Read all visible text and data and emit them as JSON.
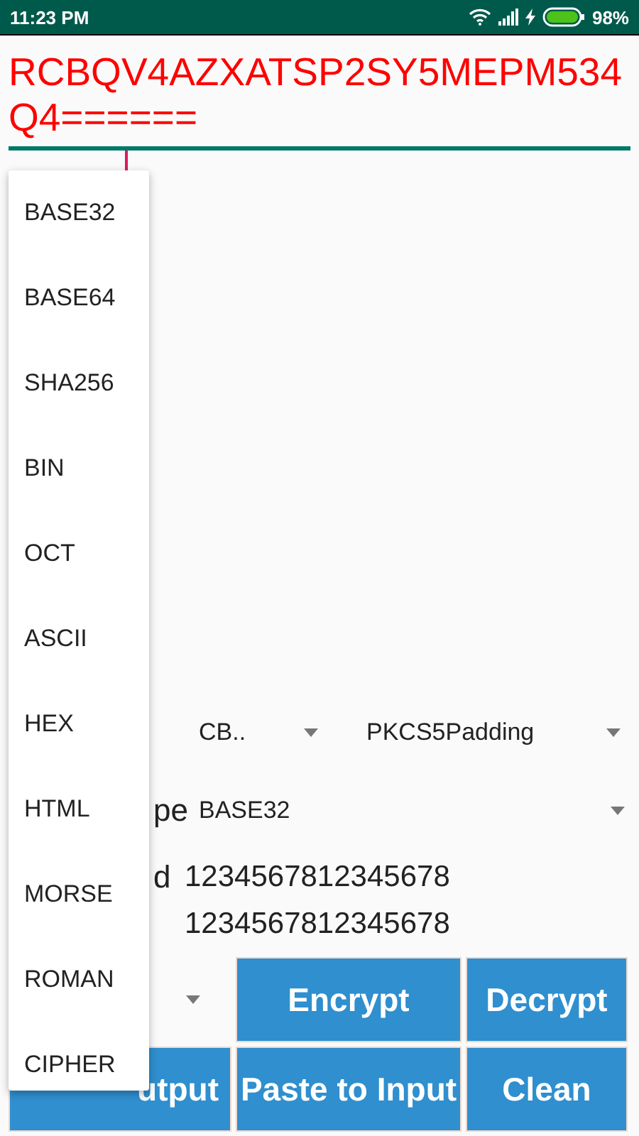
{
  "status_bar": {
    "time": "11:23 PM",
    "battery": "98%"
  },
  "output": {
    "value": "RCBQV4AZXATSP2SY5MEPM534Q4======"
  },
  "settings": {
    "mode": "CB..",
    "padding": "PKCS5Padding",
    "type_label": "pe",
    "type": "BASE32",
    "key_label": "d",
    "key": "1234567812345678",
    "iv": "1234567812345678"
  },
  "buttons": [
    {
      "label": "Encrypt"
    },
    {
      "label": "Decrypt"
    },
    {
      "label": "utput"
    },
    {
      "label": "Paste to Input"
    },
    {
      "label": "Clean"
    }
  ],
  "dropdown_menu": {
    "items": [
      "BASE32",
      "BASE64",
      "SHA256",
      "BIN",
      "OCT",
      "ASCII",
      "HEX",
      "HTML",
      "MORSE",
      "ROMAN",
      "CIPHER"
    ]
  }
}
